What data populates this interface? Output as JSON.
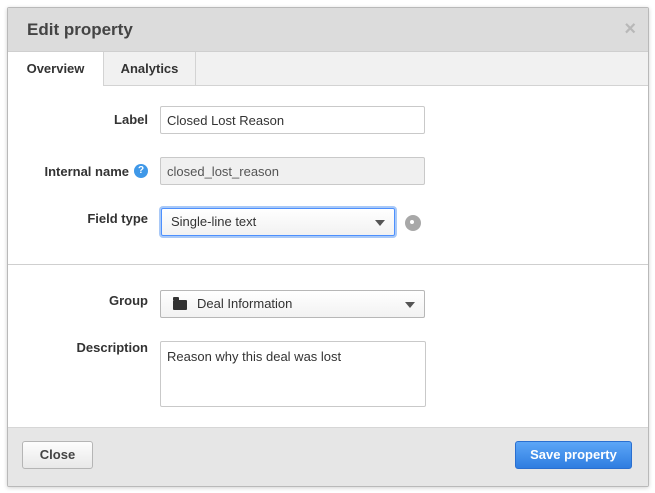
{
  "dialog": {
    "title": "Edit property",
    "close_glyph": "×"
  },
  "tabs": [
    {
      "label": "Overview",
      "active": true
    },
    {
      "label": "Analytics",
      "active": false
    }
  ],
  "form": {
    "label": {
      "label": "Label",
      "value": "Closed Lost Reason"
    },
    "internal_name": {
      "label": "Internal name",
      "value": "closed_lost_reason",
      "help_glyph": "?"
    },
    "field_type": {
      "label": "Field type",
      "value": "Single-line text"
    },
    "group": {
      "label": "Group",
      "value": "Deal Information"
    },
    "description": {
      "label": "Description",
      "value": "Reason why this deal was lost"
    }
  },
  "footer": {
    "close_label": "Close",
    "save_label": "Save property"
  },
  "colors": {
    "primary": "#2f7de0",
    "help": "#3f98e8"
  },
  "icons": [
    "close-icon",
    "help-icon",
    "settings-icon",
    "folder-icon",
    "chevron-down-icon"
  ]
}
